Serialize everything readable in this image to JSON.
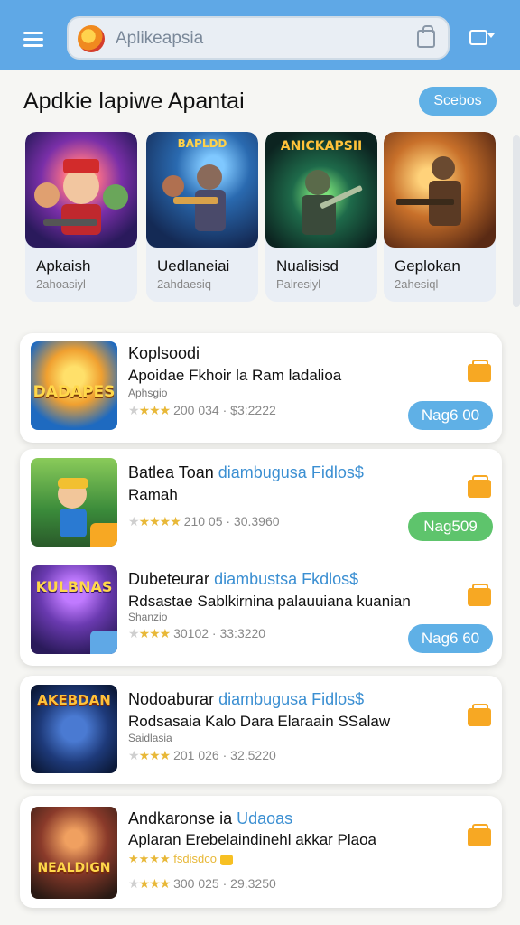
{
  "header": {
    "search_placeholder": "Aplikeapsia",
    "menu_icon": "hamburger-menu-icon",
    "cast_icon": "cast-icon",
    "bag_icon": "shopping-bag-icon"
  },
  "section": {
    "title": "Apdkie lapiwe Apantai",
    "button": "Scebos"
  },
  "featured": [
    {
      "name": "Apkaish",
      "sub": "2ahoasiyl",
      "art_text": ""
    },
    {
      "name": "Uedlaneiai",
      "sub": "2ahdaesiq",
      "art_text": "BAPLDD"
    },
    {
      "name": "Nualisisd",
      "sub": "Palresiyl",
      "art_text": "ANICKAPSII"
    },
    {
      "name": "Geplokan",
      "sub": "2ahesiql",
      "art_text": ""
    }
  ],
  "list": [
    {
      "title": "Koplsoodi",
      "title_highlight": "",
      "desc": "Apoidae Fkhoir la Ram ladalioa",
      "tag": "Aphsgio",
      "stars": "★★★",
      "meta": "200 034 · $3:2222",
      "button": "Nag6 00",
      "art_text": "DADAPES"
    },
    {
      "title": "Batlea Toan ",
      "title_highlight": "diambugusa Fidlos$",
      "desc": "Ramah",
      "tag": "",
      "stars": "★★★★",
      "meta": "210 05 · 30.3960",
      "button": "Nag509",
      "art_text": ""
    },
    {
      "title": "Dubeteurar ",
      "title_highlight": "diambustsa Fkdlos$",
      "desc": "Rdsastae Sablkirnina palauuiana kuanian",
      "tag": "Shanzio",
      "stars": "★★★",
      "meta": "30102 · 33:3220",
      "button": "Nag6 60",
      "art_text": "KULBNAS"
    },
    {
      "title": "Nodoaburar ",
      "title_highlight": "diambugusa Fidlos$",
      "desc": "Rodsasaia Kalo Dara Elaraain SSalaw",
      "tag": "Saidlasia",
      "stars": "★★★",
      "meta": "201 026 · 32.5220",
      "button": "",
      "art_text": "AKEBDAN"
    },
    {
      "title": "Andkaronse ia ",
      "title_highlight": "Udaoas",
      "desc": "Aplaran Erebelaindinehl akkar Plaoa",
      "tag": "★★★★ fsdisdco",
      "stars": "★★★",
      "meta": "300 025 · 29.3250",
      "button": "",
      "art_text": "NEALDIGN"
    }
  ],
  "colors": {
    "header_bg": "#5fa8e6",
    "accent_blue": "#5fb0e6",
    "accent_green": "#5ec46c",
    "flag_orange": "#f7a823",
    "star_gold": "#e8b838"
  }
}
